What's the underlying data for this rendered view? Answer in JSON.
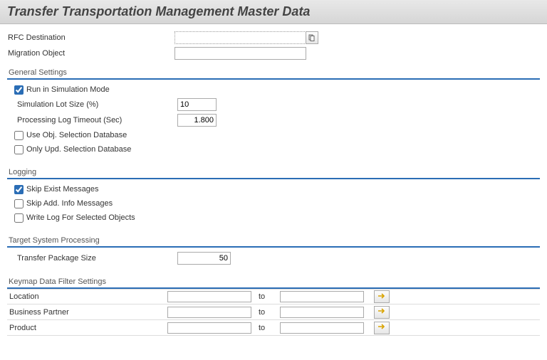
{
  "header": {
    "title": "Transfer Transportation Management Master Data"
  },
  "top": {
    "rfc_label": "RFC Destination",
    "rfc_value": "",
    "mig_label": "Migration Object",
    "mig_value": ""
  },
  "general": {
    "title": "General Settings",
    "run_sim": "Run in Simulation Mode",
    "run_sim_checked": true,
    "lot_label": "Simulation Lot Size (%)",
    "lot_value": "10",
    "timeout_label": "Processing Log Timeout (Sec)",
    "timeout_value": "1.800",
    "use_obj": "Use Obj. Selection Database",
    "only_upd": "Only Upd. Selection Database"
  },
  "logging": {
    "title": "Logging",
    "skip_exist": "Skip Exist Messages",
    "skip_exist_checked": true,
    "skip_add": "Skip Add. Info Messages",
    "write_log": "Write Log For Selected Objects"
  },
  "target": {
    "title": "Target System Processing",
    "pkg_label": "Transfer Package Size",
    "pkg_value": "50"
  },
  "keymap": {
    "title": "Keymap Data Filter Settings",
    "to_label": "to",
    "rows": [
      {
        "label": "Location",
        "from": "",
        "to": ""
      },
      {
        "label": "Business Partner",
        "from": "",
        "to": ""
      },
      {
        "label": "Product",
        "from": "",
        "to": ""
      }
    ]
  }
}
